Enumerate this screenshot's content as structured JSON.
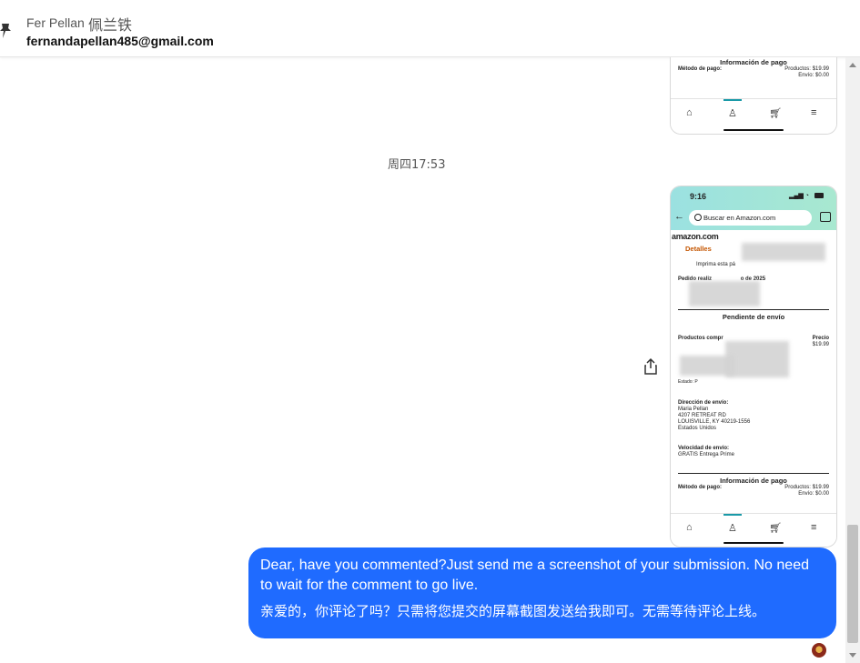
{
  "header": {
    "contact_name": "Fer Pellan",
    "contact_name_cn": "佩兰铁",
    "email": "fernandapellan485@gmail.com"
  },
  "chat": {
    "timestamp": "周四17:53",
    "message": {
      "text_en": "Dear, have you commented?Just send me a screenshot of your submission. No need to wait for the comment to go live.",
      "text_cn": "亲爱的，你评论了吗？只需将您提交的屏幕截图发送给我即可。无需等待评论上线。"
    }
  },
  "screenshot_top": {
    "payment_title": "Información de pago",
    "method_label": "Método de pago:",
    "products_label": "Productos:",
    "products_value": "$19.99",
    "shipping_label": "Envío:",
    "shipping_value": "$0.00"
  },
  "screenshot_main": {
    "status_time": "9:16",
    "search_placeholder": "Buscar en Amazon.com",
    "logo": "amazon.com",
    "details_title": "Detalles",
    "print_text": "Imprima esta pá",
    "order_label": "Pedido realiz",
    "order_date_tail": "o de 2025",
    "pending_title": "Pendiente de envío",
    "products_col": "Productos compr",
    "price_col": "Precio",
    "price_value": "$19.99",
    "status_chip": "Estado: P",
    "address_label": "Dirección de envío:",
    "address_name": "Maria Pellan",
    "address_street": "4207 RETREAT RD",
    "address_city": "LOUISVILLE, KY 40219-1556",
    "address_country": "Estados Unidos",
    "speed_label": "Velocidad de envío:",
    "speed_value": "GRATIS Entrega Prime",
    "payment_title": "Información de pago",
    "method_label": "Método de pago:",
    "products_label": "Productos:",
    "products_value": "$19.99",
    "shipping_label": "Envío:",
    "shipping_value": "$0.00"
  },
  "icons": {
    "pin": "pin-icon",
    "share": "share-icon",
    "reaction": "reaction-icon"
  }
}
